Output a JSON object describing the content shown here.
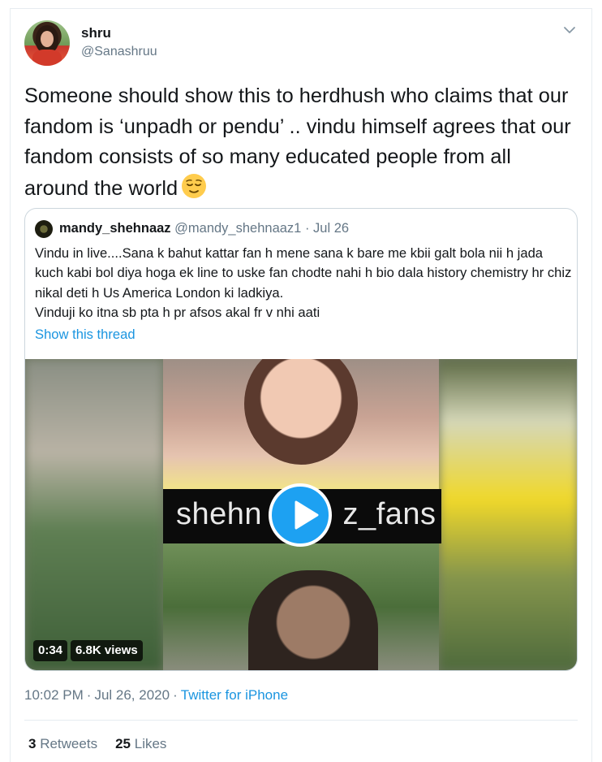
{
  "tweet": {
    "user": {
      "name": "shru",
      "handle": "@Sanashruu"
    },
    "text": "Someone should show this to herdhush who claims that our fandom is ‘unpadh or pendu’ .. vindu himself agrees that our fandom consists of so many educated people from all around the world",
    "emoji": "relieved-face-emoji",
    "quoted": {
      "name": "mandy_shehnaaz",
      "handle": "@mandy_shehnaaz1",
      "separator": "·",
      "date": "Jul 26",
      "text": "Vindu in live....Sana k bahut kattar fan h mene sana k bare me kbii galt bola nii h jada kuch kabi bol diya hoga ek line to uske fan chodte nahi h bio dala history chemistry hr chiz nikal deti h Us America London ki ladkiya.\nVinduji ko itna sb pta h pr afsos akal fr v nhi aati",
      "show_thread": "Show this thread",
      "video": {
        "overlay_text": "shehn         z_fans",
        "duration": "0:34",
        "views": "6.8K views"
      }
    },
    "time": "10:02 PM",
    "date": "Jul 26, 2020",
    "source": "Twitter for iPhone",
    "stats": {
      "retweets_count": "3",
      "retweets_label": "Retweets",
      "likes_count": "25",
      "likes_label": "Likes"
    }
  },
  "colors": {
    "link": "#1b95e0",
    "secondary_text": "#657786",
    "play_button": "#1da1f2"
  }
}
